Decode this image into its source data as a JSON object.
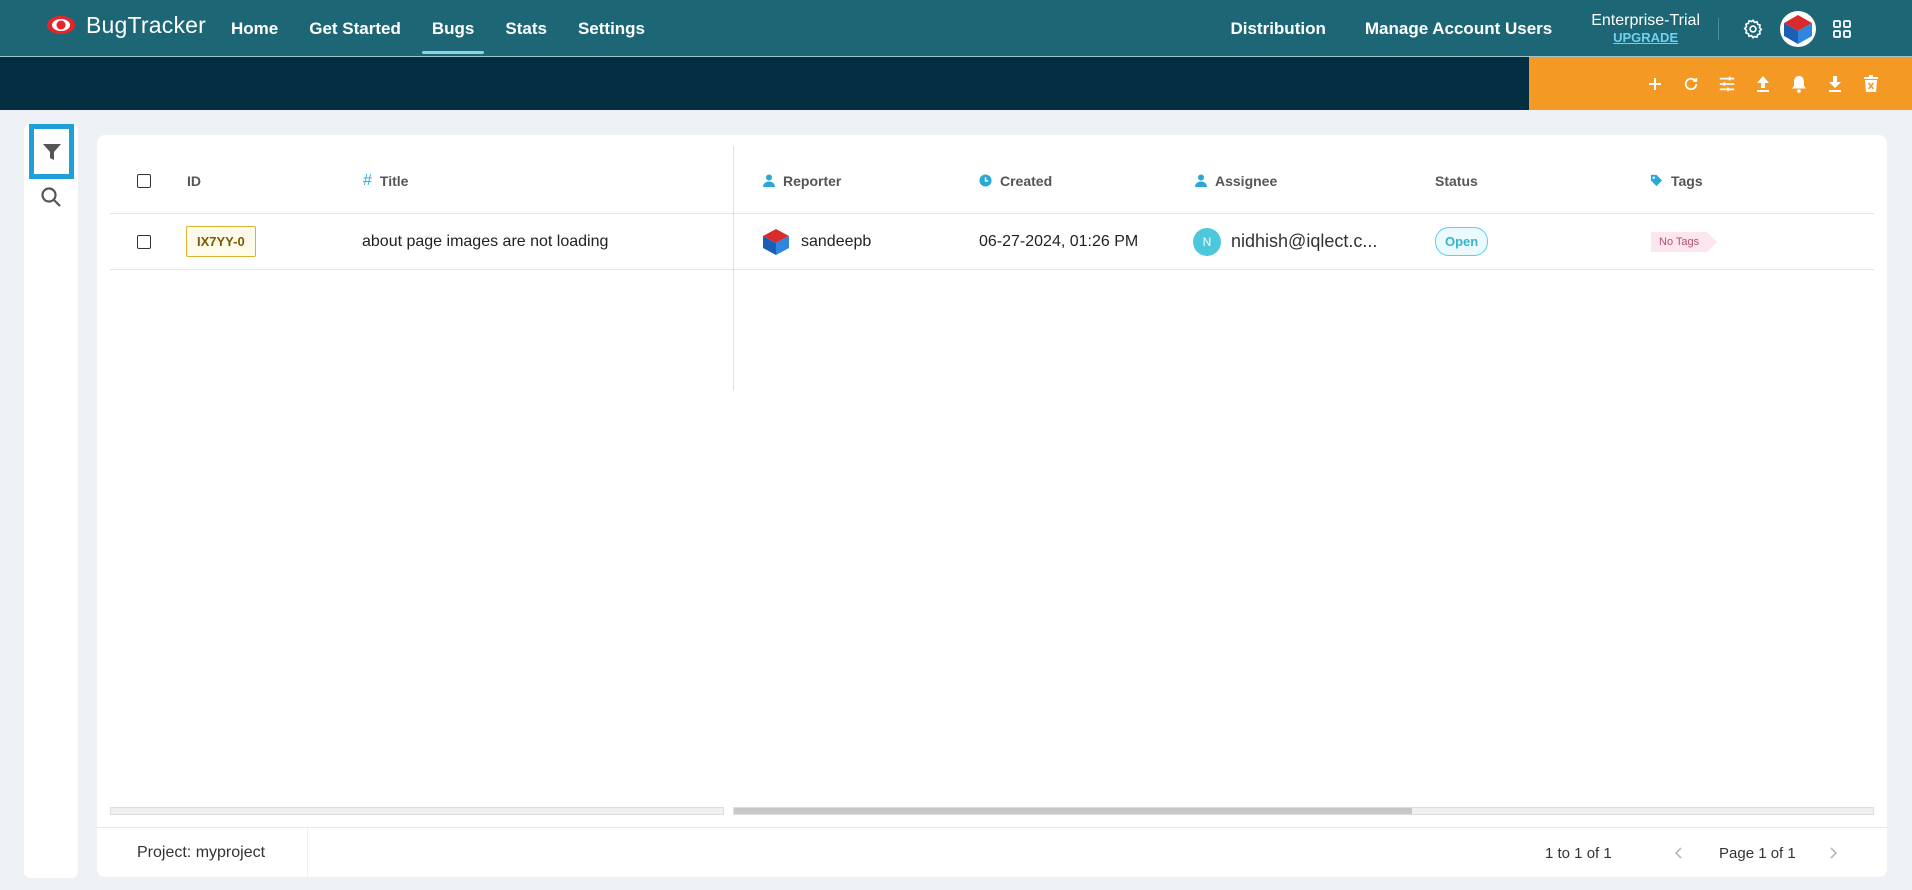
{
  "brand": {
    "name": "BugTracker",
    "logo_icon": "eye-logo-icon"
  },
  "nav": {
    "items": [
      {
        "label": "Home",
        "active": false
      },
      {
        "label": "Get Started",
        "active": false
      },
      {
        "label": "Bugs",
        "active": true
      },
      {
        "label": "Stats",
        "active": false
      },
      {
        "label": "Settings",
        "active": false
      }
    ]
  },
  "header_right": {
    "distribution": "Distribution",
    "manage_users": "Manage Account Users",
    "plan_name": "Enterprise-Trial",
    "upgrade": "UPGRADE"
  },
  "toolbar": {
    "actions": [
      "add-icon",
      "refresh-icon",
      "tune-icon",
      "upload-icon",
      "bell-icon",
      "download-icon",
      "delete-icon"
    ]
  },
  "colors": {
    "topbar": "#1d6675",
    "subbar": "#032d40",
    "actionbar": "#f49a24",
    "accent": "#1e9fd8"
  },
  "table": {
    "columns": {
      "id": "ID",
      "title": "Title",
      "reporter": "Reporter",
      "created": "Created",
      "assignee": "Assignee",
      "status": "Status",
      "tags": "Tags"
    },
    "rows": [
      {
        "id": "IX7YY-0",
        "title": "about page images are not loading",
        "reporter": "sandeepb",
        "created": "06-27-2024, 01:26 PM",
        "assignee_initial": "N",
        "assignee": "nidhish@iqlect.c...",
        "status": "Open",
        "tags": "No Tags"
      }
    ]
  },
  "footer": {
    "project": "Project: myproject",
    "range": "1 to 1 of 1",
    "page": "Page 1 of 1"
  }
}
